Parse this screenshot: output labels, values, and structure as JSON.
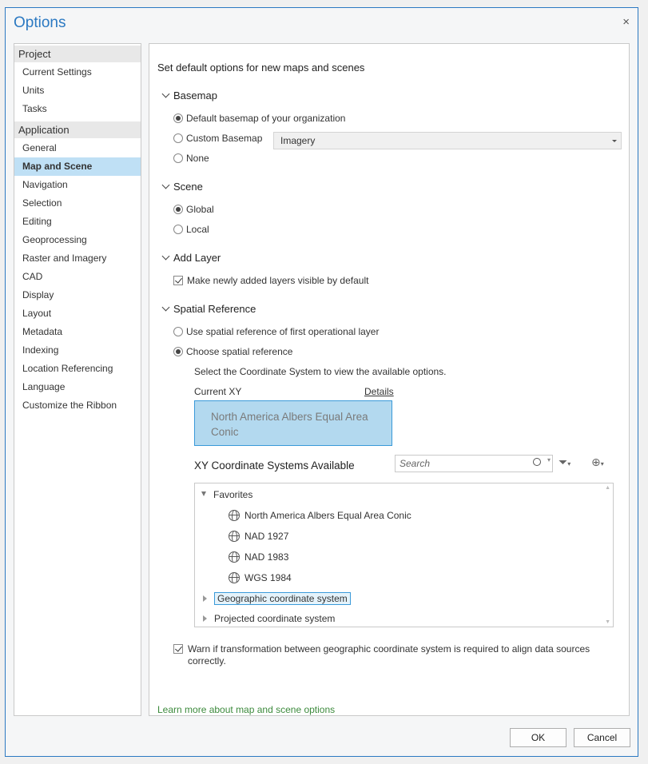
{
  "window": {
    "title": "Options",
    "close_label": "×"
  },
  "sidebar": {
    "groups": [
      {
        "title": "Project",
        "items": [
          "Current Settings",
          "Units",
          "Tasks"
        ]
      },
      {
        "title": "Application",
        "items": [
          "General",
          "Map and Scene",
          "Navigation",
          "Selection",
          "Editing",
          "Geoprocessing",
          "Raster and Imagery",
          "CAD",
          "Display",
          "Layout",
          "Metadata",
          "Indexing",
          "Location Referencing",
          "Language",
          "Customize the Ribbon"
        ]
      }
    ],
    "selected": "Map and Scene"
  },
  "main": {
    "heading": "Set default options for new maps and scenes",
    "basemap": {
      "title": "Basemap",
      "options": [
        "Default basemap of your organization",
        "Custom Basemap",
        "None"
      ],
      "selected": "Default basemap of your organization",
      "custom_value": "Imagery"
    },
    "scene": {
      "title": "Scene",
      "options": [
        "Global",
        "Local"
      ],
      "selected": "Global"
    },
    "add_layer": {
      "title": "Add Layer",
      "checkbox_label": "Make newly added layers visible by default",
      "checked": true
    },
    "spatial_reference": {
      "title": "Spatial Reference",
      "options": [
        "Use spatial reference of first operational layer",
        "Choose spatial reference"
      ],
      "selected": "Choose spatial reference",
      "instruction": "Select the Coordinate System to view the available options.",
      "current_label": "Current XY",
      "details_link": "Details",
      "current_value": "North America Albers Equal Area Conic",
      "available_label": "XY Coordinate Systems Available",
      "search_placeholder": "Search",
      "tree": {
        "favorites_label": "Favorites",
        "favorites": [
          "North America Albers Equal Area Conic",
          "NAD 1927",
          "NAD 1983",
          "WGS 1984"
        ],
        "geographic": "Geographic coordinate system",
        "projected": "Projected coordinate system"
      }
    },
    "warn_checkbox": {
      "label": "Warn if transformation between geographic coordinate system is required to align data sources correctly.",
      "checked": true
    },
    "learn_more": "Learn more about map and scene options"
  },
  "buttons": {
    "ok": "OK",
    "cancel": "Cancel"
  },
  "icons": {
    "search": "search-icon",
    "filter": "filter-icon",
    "globe_add": "add-coordinate-system-icon",
    "globe": "globe-icon"
  },
  "colors": {
    "accent": "#2b79c2",
    "selected": "#bfe0f5",
    "link": "#3c8a3c"
  }
}
